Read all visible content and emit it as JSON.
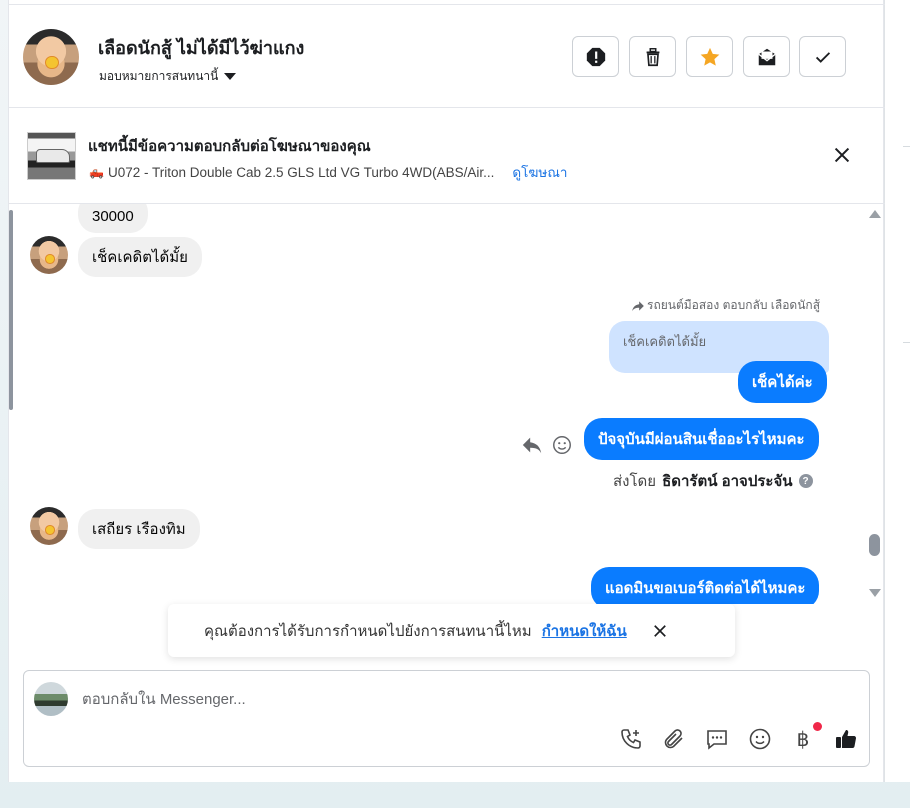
{
  "header": {
    "contact_name": "เลือดนักสู้ ไม่ได้มีไว้ฆ่าแกง",
    "assign_label": "มอบหมายการสนทนานี้",
    "actions": [
      {
        "name": "spam",
        "icon": "alert-icon"
      },
      {
        "name": "delete",
        "icon": "trash-icon"
      },
      {
        "name": "star",
        "icon": "star-icon",
        "color": "#f5a623"
      },
      {
        "name": "mark-unread",
        "icon": "envelope-icon"
      },
      {
        "name": "done",
        "icon": "check-icon"
      }
    ]
  },
  "ad_banner": {
    "title": "แชทนี้มีข้อความตอบกลับต่อโฆษณาของคุณ",
    "subtitle": "U072 - Triton Double Cab 2.5 GLS Ltd VG Turbo 4WD(ABS/Air...",
    "link": "ดูโฆษณา"
  },
  "messages": {
    "incoming_1": "30000",
    "incoming_2": "เช็คเคดิตได้มั้ย",
    "reply_label": "รถยนต์มือสอง ตอบกลับ เลือดนักสู้",
    "quoted_text": "เช็คเคดิตได้มั้ย",
    "outgoing_1": "เช็คได้ค่ะ",
    "outgoing_2": "ปัจจุบันมีผ่อนสินเชื่ออะไรไหมคะ",
    "sent_by_prefix": "ส่งโดย",
    "sent_by_name": "ธิดารัตน์ อาจประจัน",
    "help": "?",
    "incoming_3": "เสถียร เรืองทิม",
    "outgoing_3": "แอดมินขอเบอร์ติดต่อได้ไหมคะ"
  },
  "assign_prompt": {
    "text": "คุณต้องการได้รับการกำหนดไปยังการสนทนานี้ไหม",
    "link": "กำหนดให้ฉัน"
  },
  "composer": {
    "placeholder": "ตอบกลับใน Messenger...",
    "baht_symbol": "฿",
    "tools": [
      "call-icon",
      "attachment-icon",
      "saved-replies-icon",
      "emoji-icon",
      "baht-icon",
      "like-icon"
    ]
  },
  "colors": {
    "accent": "#0a7cff",
    "link": "#1b74e4",
    "star": "#f5a623",
    "notification": "#f02849"
  }
}
